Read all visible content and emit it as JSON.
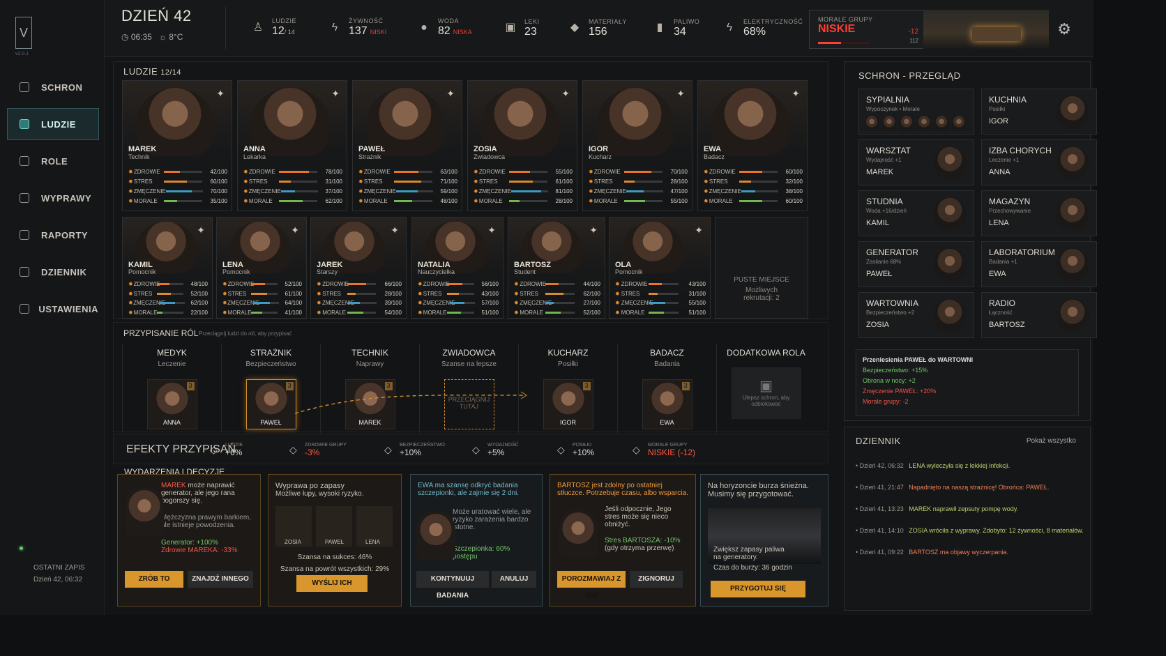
{
  "app": {
    "logo": "V",
    "version": "v2.0.1",
    "last_save_label": "OSTATNI ZAPIS",
    "last_save_value": "Dzień 42, 06:32"
  },
  "nav": [
    {
      "label": "SCHRON",
      "icon": "house-icon"
    },
    {
      "label": "LUDZIE",
      "icon": "people-icon"
    },
    {
      "label": "ROLE",
      "icon": "roles-icon"
    },
    {
      "label": "WYPRAWY",
      "icon": "compass-icon"
    },
    {
      "label": "RAPORTY",
      "icon": "report-icon"
    },
    {
      "label": "DZIENNIK",
      "icon": "book-icon"
    },
    {
      "label": "USTAWIENIA",
      "icon": "gear-icon"
    }
  ],
  "top": {
    "day": "DZIEŃ 42",
    "time": "06:35",
    "weather": "8°C",
    "stats": [
      {
        "label": "LUDZIE",
        "value": "12",
        "sub": "/ 14"
      },
      {
        "label": "ŻYWNOŚĆ",
        "value": "137",
        "sub": "NISKI"
      },
      {
        "label": "WODA",
        "value": "82",
        "sub": "NISKA"
      },
      {
        "label": "LEKI",
        "value": "23",
        "sub": ""
      },
      {
        "label": "MATERIAŁY",
        "value": "156",
        "sub": ""
      },
      {
        "label": "PALIWO",
        "value": "34",
        "sub": ""
      },
      {
        "label": "ELEKTRYCZNOŚĆ",
        "value": "68%",
        "sub": ""
      }
    ],
    "morale_label": "MORALE GRUPY",
    "morale": "NISKIE",
    "morale_change": "-12",
    "morale_value": "112",
    "morale_fill": 0.45
  },
  "people": {
    "title": "LUDZIE",
    "count": "12/14",
    "labels": [
      "ZDROWIE",
      "STRES",
      "ZMĘCZENIE",
      "MORALE"
    ],
    "cards": [
      {
        "name": "MAREK",
        "role": "Technik",
        "stats": [
          "42/100",
          "60/100",
          "70/100",
          "35/100"
        ],
        "fills": [
          0.42,
          0.6,
          0.7,
          0.35
        ]
      },
      {
        "name": "ANNA",
        "role": "Lekarka",
        "stats": [
          "78/100",
          "31/100",
          "37/100",
          "62/100"
        ],
        "fills": [
          0.78,
          0.31,
          0.37,
          0.62
        ]
      },
      {
        "name": "PAWEŁ",
        "role": "Strażnik",
        "stats": [
          "63/100",
          "71/100",
          "59/100",
          "48/100"
        ],
        "fills": [
          0.63,
          0.71,
          0.59,
          0.48
        ]
      },
      {
        "name": "ZOSIA",
        "role": "Zwiadowca",
        "stats": [
          "55/100",
          "61/100",
          "81/100",
          "28/100"
        ],
        "fills": [
          0.55,
          0.61,
          0.81,
          0.28
        ]
      },
      {
        "name": "IGOR",
        "role": "Kucharz",
        "stats": [
          "70/100",
          "28/100",
          "47/100",
          "55/100"
        ],
        "fills": [
          0.7,
          0.28,
          0.47,
          0.55
        ]
      },
      {
        "name": "EWA",
        "role": "Badacz",
        "stats": [
          "60/100",
          "32/100",
          "38/100",
          "60/100"
        ],
        "fills": [
          0.6,
          0.32,
          0.38,
          0.6
        ]
      },
      {
        "name": "KAMIL",
        "role": "Pomocnik",
        "stats": [
          "48/100",
          "52/100",
          "62/100",
          "22/100"
        ],
        "fills": [
          0.48,
          0.52,
          0.62,
          0.22
        ]
      },
      {
        "name": "LENA",
        "role": "Pomocnik",
        "stats": [
          "52/100",
          "61/100",
          "64/100",
          "41/100"
        ],
        "fills": [
          0.52,
          0.61,
          0.64,
          0.41
        ]
      },
      {
        "name": "JAREK",
        "role": "Starszy",
        "stats": [
          "66/100",
          "28/100",
          "39/100",
          "54/100"
        ],
        "fills": [
          0.66,
          0.28,
          0.39,
          0.54
        ]
      },
      {
        "name": "NATALIA",
        "role": "Nauczycielka",
        "stats": [
          "56/100",
          "43/100",
          "57/100",
          "51/100"
        ],
        "fills": [
          0.56,
          0.43,
          0.57,
          0.51
        ]
      },
      {
        "name": "BARTOSZ",
        "role": "Student",
        "stats": [
          "44/100",
          "62/100",
          "27/100",
          "52/100"
        ],
        "fills": [
          0.44,
          0.62,
          0.27,
          0.52
        ]
      },
      {
        "name": "OLA",
        "role": "Pomocnik",
        "stats": [
          "43/100",
          "31/100",
          "55/100",
          "51/100"
        ],
        "fills": [
          0.43,
          0.31,
          0.55,
          0.51
        ]
      }
    ],
    "empty_title": "PUSTE MIEJSCE",
    "empty_sub": "Możliwych rekrutacji: 2"
  },
  "roles": {
    "title": "PRZYPISANIE RÓL",
    "hint": "Przeciągnij ludzi do ról, aby przypisać",
    "items": [
      {
        "title": "MEDYK",
        "sub": "Leczenie",
        "person": "ANNA",
        "level": "3"
      },
      {
        "title": "STRAŻNIK",
        "sub": "Bezpieczeństwo",
        "person": "PAWEŁ",
        "level": "3"
      },
      {
        "title": "TECHNIK",
        "sub": "Naprawy",
        "person": "MAREK",
        "level": "3"
      },
      {
        "title": "ZWIADOWCA",
        "sub": "Szanse na lepsze",
        "drop": "PRZECIĄGNIJ TUTAJ"
      },
      {
        "title": "KUCHARZ",
        "sub": "Posiłki",
        "person": "IGOR",
        "level": "3"
      },
      {
        "title": "BADACZ",
        "sub": "Badania",
        "person": "EWA",
        "level": "3"
      },
      {
        "title": "DODATKOWA ROLA",
        "lock": "Ulepsz schron, aby odblokować"
      }
    ]
  },
  "effects": {
    "title": "EFEKTY PRZYPISAŃ",
    "items": [
      {
        "label": "LUDZIE",
        "value": "+6%"
      },
      {
        "label": "ZDROWIE GRUPY",
        "value": "-3%"
      },
      {
        "label": "BEZPIECZEŃSTWO",
        "value": "+10%"
      },
      {
        "label": "WYDAJNOŚĆ",
        "value": "+5%"
      },
      {
        "label": "POSIŁKI",
        "value": "+10%"
      },
      {
        "label": "MORALE GRUPY",
        "value": "NISKIE (-12)"
      }
    ]
  },
  "events": {
    "title": "WYDARZENIA I DECYZJE",
    "items": [
      {
        "name": "MAREK",
        "text": "może naprawić generator, ale jego rana pogorszy się.",
        "detail": "Mężczyzna prawym barkiem, ale istnieje powodzenia.",
        "good": "Generator: +100%",
        "bad": "Zdrowie MAREKA: -33%",
        "b1": "ZRÓB TO",
        "b2": "ZNAJDŹ INNEGO"
      },
      {
        "title": "Wyprawa po zapasy",
        "sub": "Możliwe łupy, wysoki ryzyko.",
        "people": [
          "ZOSIA",
          "PAWEŁ",
          "LENA"
        ],
        "chance": "Szansa na sukces: 46%",
        "back": "Szansa na powrót wszystkich: 29%",
        "b1": "WYŚLIJ ICH"
      },
      {
        "title": "EWA ma szansę odkryć badania szczepionki, ale zajmie się 2 dni.",
        "detail": "Może uratować wiele, ale ryzyko zarażenia bardzo istotne.",
        "good": "Szczepionka: 60% postępu",
        "b1": "KONTYNUUJ BADANIA",
        "b2": "ANULUJ"
      },
      {
        "title": "BARTOSZ jest zdolny po ostatniej stłuczce. Potrzebuje czasu, albo wsparcia.",
        "detail": "Jeśli odpocznie, Jego stres może się nieco obniżyć.",
        "good": "Stres BARTOSZA: -10%",
        "sub": "(gdy otrzyma przerwę)",
        "b1": "POROZMAWIAJ Z NIM",
        "b2": "ZIGNORUJ"
      },
      {
        "title": "Na horyzoncie burza śnieżna. Musimy się przygotować.",
        "detail": "Zwiększ zapasy paliwa na generatory.",
        "time": "Czas do burzy: 36 godzin",
        "b1": "PRZYGOTUJ SIĘ"
      }
    ]
  },
  "shelter": {
    "title": "SCHRON - PRZEGLĄD",
    "rooms": [
      {
        "name": "SYPIALNIA",
        "sub": "Wypoczynek • Morale",
        "person": "6/6"
      },
      {
        "name": "KUCHNIA",
        "sub": "Posiłki",
        "person": "IGOR"
      },
      {
        "name": "WARSZTAT",
        "sub": "Wydajność +1",
        "person": "MAREK"
      },
      {
        "name": "IZBA CHORYCH",
        "sub": "Leczenie +1",
        "person": "ANNA"
      },
      {
        "name": "STUDNIA",
        "sub": "Woda +16/dzień",
        "person": "KAMIL"
      },
      {
        "name": "MAGAZYN",
        "sub": "Przechowywanie",
        "person": "LENA"
      },
      {
        "name": "GENERATOR",
        "sub": "Zasilanie 68%",
        "person": "PAWEŁ"
      },
      {
        "name": "LABORATORIUM",
        "sub": "Badania +1",
        "person": "EWA"
      },
      {
        "name": "WARTOWNIA",
        "sub": "Bezpieczeństwo +2",
        "person": "ZOSIA"
      },
      {
        "name": "RADIO",
        "sub": "Łączność",
        "person": "BARTOSZ"
      }
    ],
    "transfer_title": "Przeniesienia PAWEŁ do WARTOWNI",
    "transfer": [
      "Bezpieczeństwo: +15%",
      "Obrona w nocy: +2",
      "Zmęczenie PAWEŁ: +20%",
      "Morale grupy: -2"
    ]
  },
  "journal": {
    "title": "DZIENNIK",
    "link": "Pokaż wszystko",
    "rows": [
      {
        "time": "Dzień 42, 06:32",
        "text": "LENA wyleczyła się z lekkiej infekcji."
      },
      {
        "time": "Dzień 41, 21:47",
        "text": "Napadnięto na naszą strażnicę! Obrońca: PAWEŁ."
      },
      {
        "time": "Dzień 41, 13:23",
        "text": "MAREK naprawił zepsuty pompę wody."
      },
      {
        "time": "Dzień 41, 14:10",
        "text": "ZOSIA wróciła z wyprawy. Zdobyto: 12 żywności, 8 materiałów."
      },
      {
        "time": "Dzień 41, 09:22",
        "text": "BARTOSZ ma objawy wyczerpania."
      }
    ]
  },
  "colors": {
    "health": "#e8752a",
    "stress": "#d88a31",
    "fatigue": "#3d9cc3",
    "morale": "#71b84c",
    "danger": "#ff3e35",
    "gold": "#d8962d"
  }
}
